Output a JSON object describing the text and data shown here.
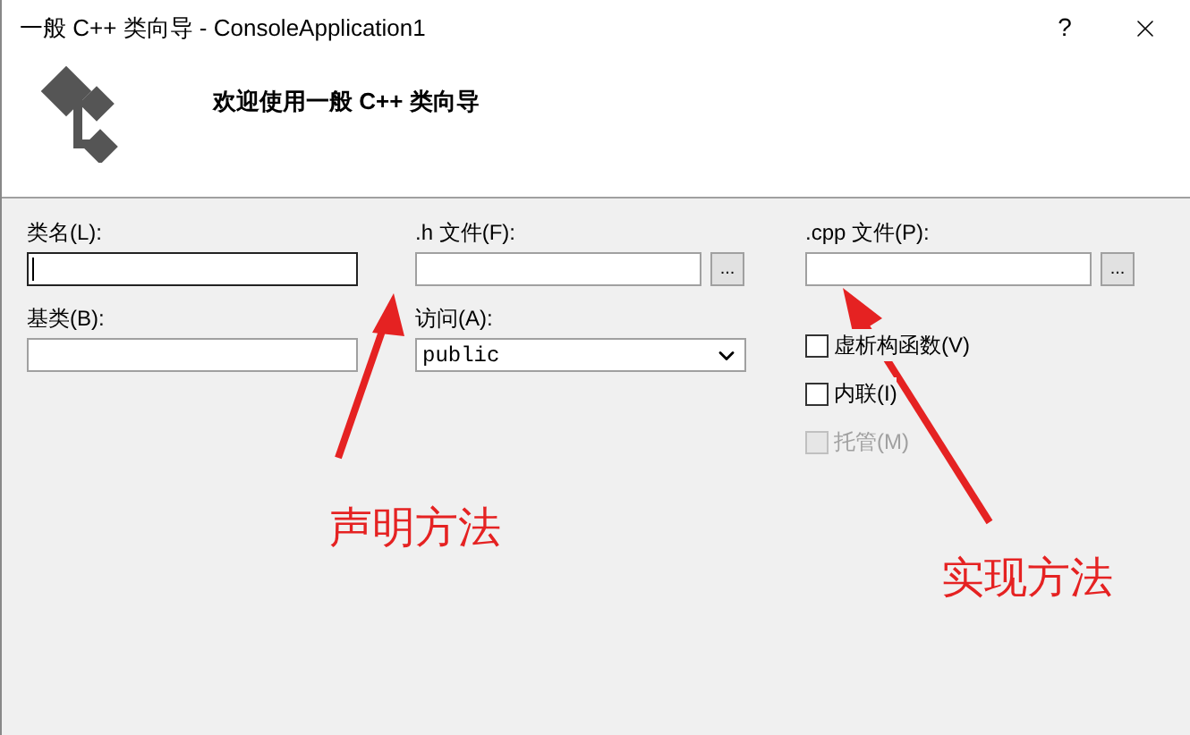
{
  "window": {
    "title": "一般 C++ 类向导 - ConsoleApplication1",
    "help": "?"
  },
  "header": {
    "heading": "欢迎使用一般 C++ 类向导"
  },
  "fields": {
    "class_name": {
      "label": "类名(L):",
      "focused": true
    },
    "base_class": {
      "label": "基类(B):"
    },
    "h_file": {
      "label": ".h 文件(F):",
      "browse": "..."
    },
    "access": {
      "label": "访问(A):",
      "value": "public"
    },
    "cpp_file": {
      "label": ".cpp 文件(P):",
      "browse": "..."
    }
  },
  "options": [
    {
      "label": "虚析构函数(V)",
      "checked": false,
      "disabled": false
    },
    {
      "label": "内联(I)",
      "checked": false,
      "disabled": false
    },
    {
      "label": "托管(M)",
      "checked": false,
      "disabled": true
    }
  ],
  "annotations": [
    {
      "text": "声明方法"
    },
    {
      "text": "实现方法"
    }
  ]
}
